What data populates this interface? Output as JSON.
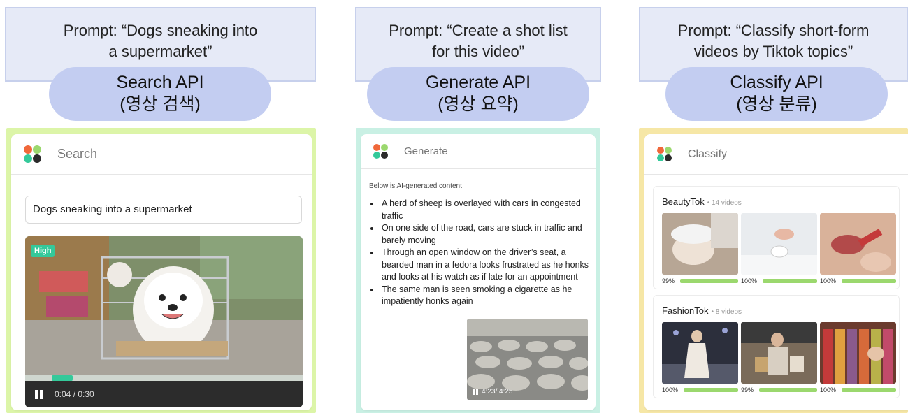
{
  "columns": [
    {
      "prompt": "Prompt: “Dogs sneaking into\na supermarket”",
      "api_line1": "Search API",
      "api_line2": "(영상 검색)",
      "panel_color": "#dcf5a8",
      "card": {
        "title": "Search",
        "search_value": "Dogs sneaking into a supermarket",
        "badge": "High",
        "time": "0:04 / 0:30",
        "progress": 0.135
      }
    },
    {
      "prompt": "Prompt: “Create a shot list\nfor this video”",
      "api_line1": "Generate API",
      "api_line2": "(영상 요약)",
      "panel_color": "#c9f0e4",
      "card": {
        "title": "Generate",
        "note": "Below is AI-generated content",
        "bullets": [
          "A herd of sheep is overlayed with cars in congested traffic",
          "On one side of the road, cars are stuck in traffic and barely moving",
          "Through an open window on the driver’s seat, a bearded man in a fedora looks frustrated as he honks and looks at his watch as if late for an appointment",
          "The same man is seen smoking a cigarette as he impatiently honks again"
        ],
        "time": "4:23/ 4:25"
      }
    },
    {
      "prompt": "Prompt: “Classify short-form\nvideos by Tiktok topics”",
      "api_line1": "Classify API",
      "api_line2": "(영상 분류)",
      "panel_color": "#f6e7a6",
      "card": {
        "title": "Classify",
        "groups": [
          {
            "name": "BeautyTok",
            "count": "• 14 videos",
            "items": [
              {
                "pct": "99%",
                "score": 0.99
              },
              {
                "pct": "100%",
                "score": 1.0
              },
              {
                "pct": "100%",
                "score": 1.0
              }
            ]
          },
          {
            "name": "FashionTok",
            "count": "• 8 videos",
            "items": [
              {
                "pct": "100%",
                "score": 1.0
              },
              {
                "pct": "99%",
                "score": 0.99
              },
              {
                "pct": "100%",
                "score": 1.0
              }
            ]
          }
        ]
      }
    }
  ]
}
